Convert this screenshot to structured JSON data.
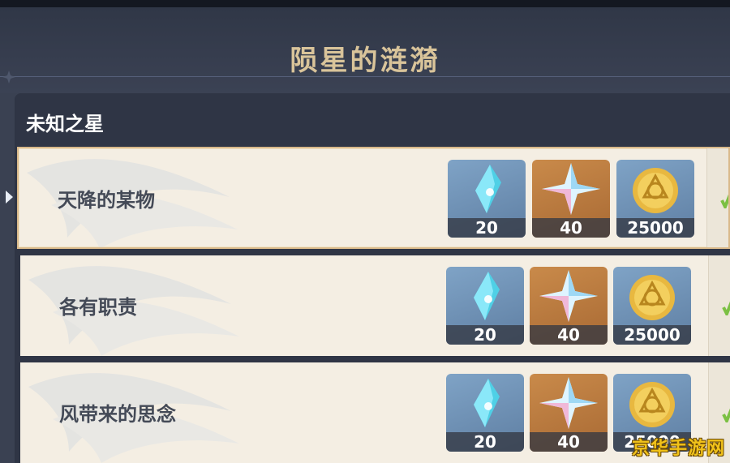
{
  "title": "陨星的涟漪",
  "section": {
    "title": "未知之星"
  },
  "quests": [
    {
      "name": "天降的某物",
      "selected": true,
      "rewards": [
        {
          "item": "crystal-icon",
          "count": "20"
        },
        {
          "item": "primogem-icon",
          "count": "40"
        },
        {
          "item": "mora-icon",
          "count": "25000"
        }
      ]
    },
    {
      "name": "各有职责",
      "selected": false,
      "rewards": [
        {
          "item": "crystal-icon",
          "count": "20"
        },
        {
          "item": "primogem-icon",
          "count": "40"
        },
        {
          "item": "mora-icon",
          "count": "25000"
        }
      ]
    },
    {
      "name": "风带来的思念",
      "selected": false,
      "rewards": [
        {
          "item": "crystal-icon",
          "count": "20"
        },
        {
          "item": "primogem-icon",
          "count": "40"
        },
        {
          "item": "mora-icon",
          "count": "25000"
        }
      ]
    }
  ],
  "watermark": "京华手游网",
  "colors": {
    "title": "#d9c49a",
    "row_bg": "#f4eee3",
    "selected_border": "#d9b98a",
    "check": "#7bc043",
    "watermark": "#f1c21a"
  }
}
